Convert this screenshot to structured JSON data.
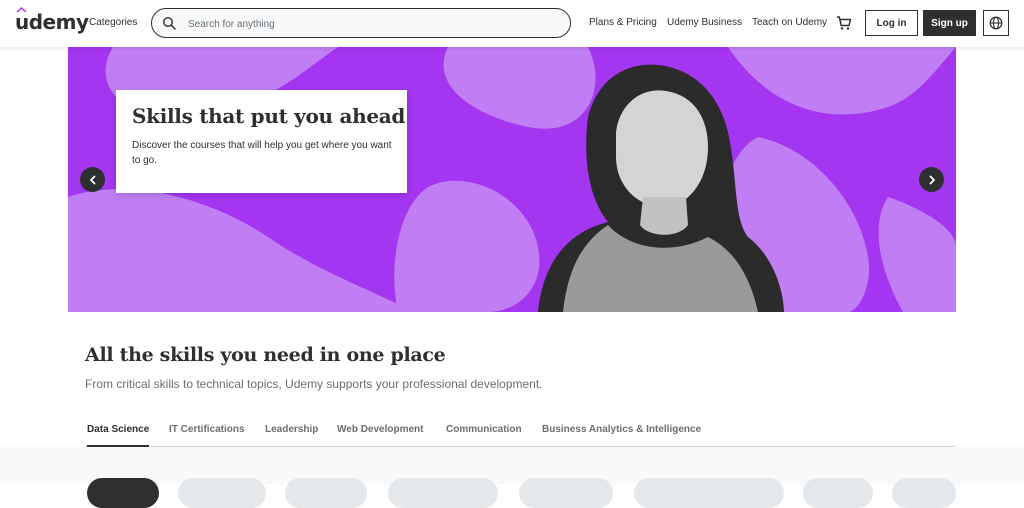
{
  "header": {
    "logo": "udemy",
    "categories_label": "Categories",
    "search_placeholder": "Search for anything",
    "plans_label": "Plans & Pricing",
    "business_label": "Udemy Business",
    "teach_label": "Teach on Udemy",
    "cart_icon": "cart-icon",
    "login_label": "Log in",
    "signup_label": "Sign up",
    "language_icon": "globe-icon"
  },
  "hero": {
    "title": "Skills that put you ahead",
    "description": "Discover the courses that will help you get where you want to go.",
    "prev_icon": "chevron-left-icon",
    "next_icon": "chevron-right-icon",
    "background_color": "#a435f0",
    "blob_color": "#c17ef4"
  },
  "skills_section": {
    "title": "All the skills you need in one place",
    "subtitle": "From critical skills to technical topics, Udemy supports your professional development.",
    "tabs": [
      {
        "label": "Data Science",
        "active": true
      },
      {
        "label": "IT Certifications",
        "active": false
      },
      {
        "label": "Leadership",
        "active": false
      },
      {
        "label": "Web Development",
        "active": false
      },
      {
        "label": "Communication",
        "active": false
      },
      {
        "label": "Business Analytics & Intelligence",
        "active": false
      }
    ]
  },
  "colors": {
    "brand_purple": "#a435f0",
    "dark": "#2d2f31",
    "muted_text": "#6a6f73"
  }
}
